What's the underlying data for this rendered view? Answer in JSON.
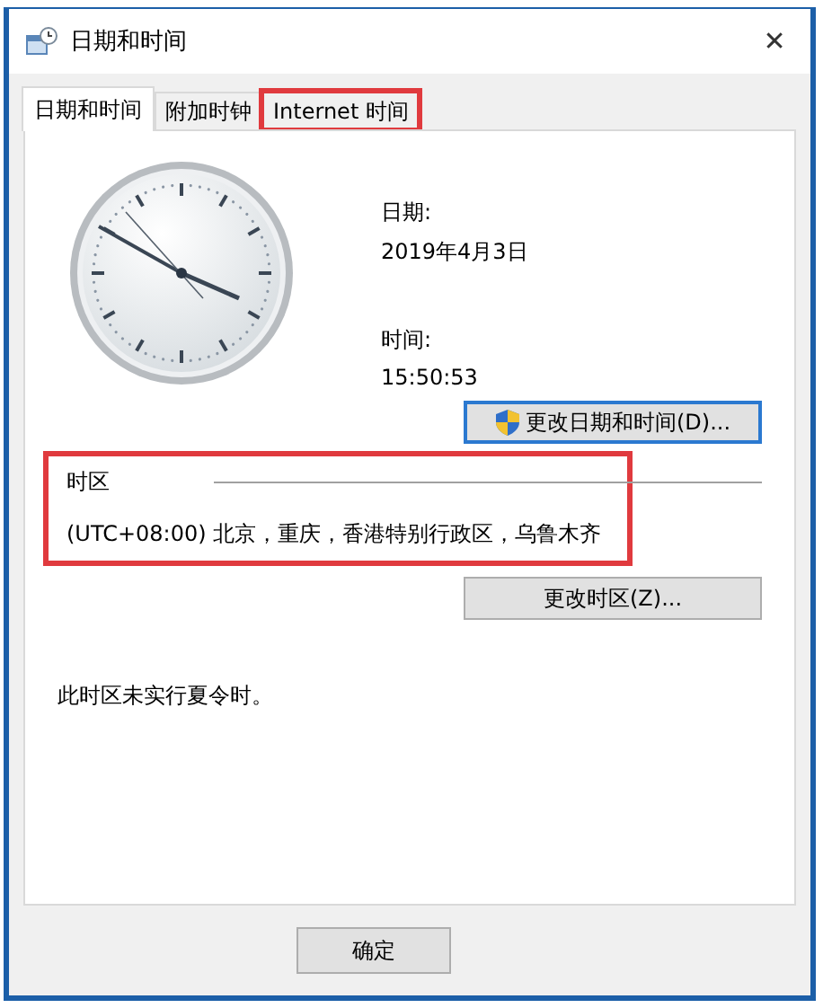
{
  "window": {
    "title": "日期和时间",
    "close": "✕"
  },
  "tabs": [
    {
      "label": "日期和时间",
      "selected": true,
      "highlighted": false
    },
    {
      "label": "附加时钟",
      "selected": false,
      "highlighted": false
    },
    {
      "label": "Internet 时间",
      "selected": false,
      "highlighted": true
    }
  ],
  "date": {
    "label": "日期:",
    "value": "2019年4月3日"
  },
  "time": {
    "label": "时间:",
    "value": "15:50:53"
  },
  "change_datetime_button": {
    "label": "更改日期和时间(D)...",
    "focused": true
  },
  "timezone": {
    "heading": "时区",
    "value": "(UTC+08:00) 北京，重庆，香港特别行政区，乌鲁木齐",
    "highlighted": true
  },
  "change_timezone_button": {
    "label": "更改时区(Z)..."
  },
  "dst_note": "此时区未实行夏令时。",
  "buttons": [
    "确定"
  ]
}
